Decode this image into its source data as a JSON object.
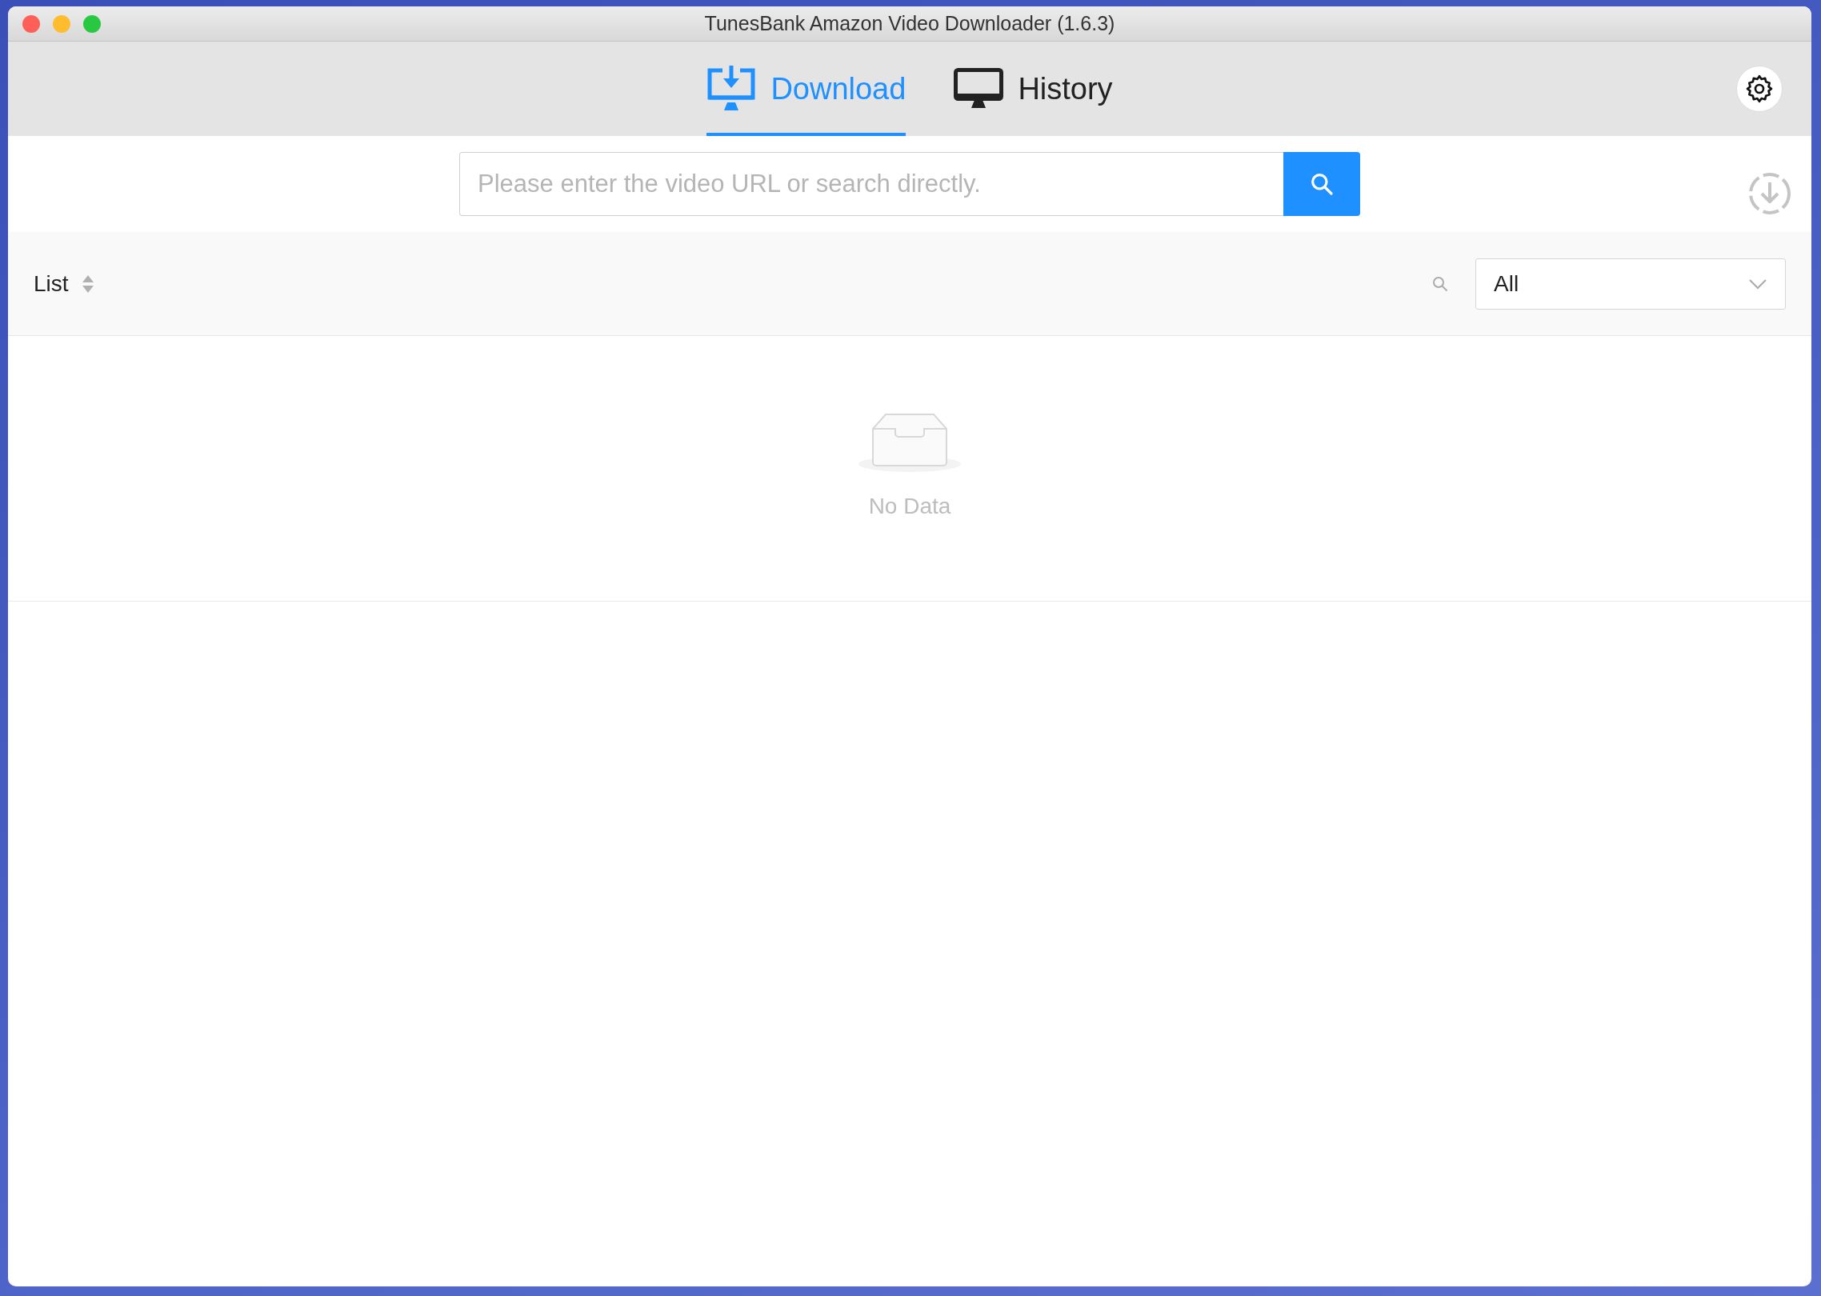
{
  "window": {
    "title": "TunesBank Amazon Video Downloader (1.6.3)"
  },
  "tabs": [
    {
      "label": "Download",
      "selected": true,
      "kind": "download"
    },
    {
      "label": "History",
      "selected": false,
      "kind": "history"
    }
  ],
  "search": {
    "placeholder": "Please enter the video URL or search directly."
  },
  "list_bar": {
    "label": "List",
    "filter": "All"
  },
  "empty_state": {
    "text": "No Data"
  }
}
